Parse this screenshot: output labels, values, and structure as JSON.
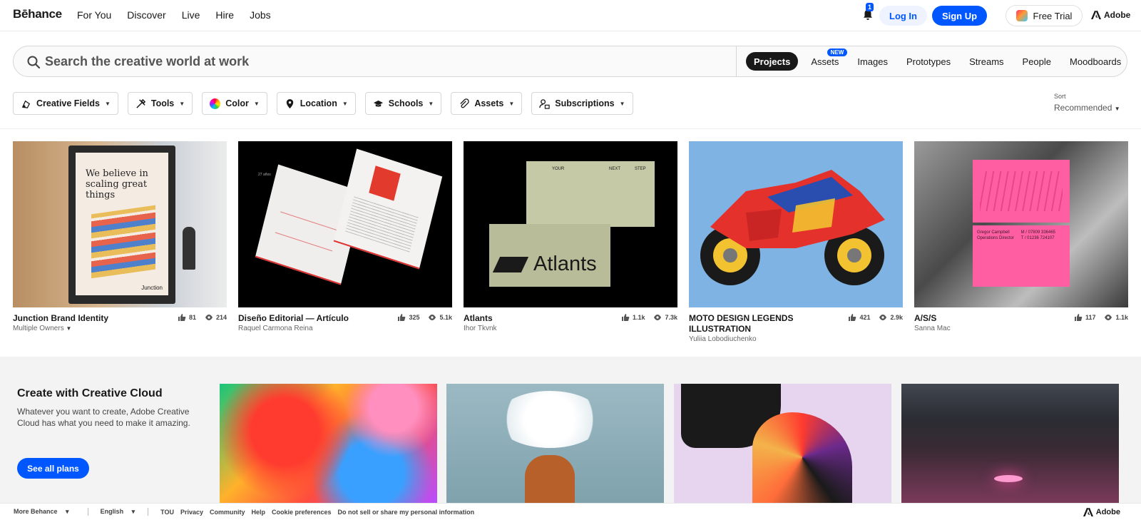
{
  "brand": {
    "logo": "Bēhance"
  },
  "nav": {
    "links": [
      "For You",
      "Discover",
      "Live",
      "Hire",
      "Jobs"
    ]
  },
  "header": {
    "notification_count": "1",
    "login": "Log In",
    "signup": "Sign Up",
    "trial": "Free Trial",
    "adobe": "Adobe"
  },
  "search": {
    "placeholder": "Search the creative world at work",
    "tabs": [
      "Projects",
      "Assets",
      "Images",
      "Prototypes",
      "Streams",
      "People",
      "Moodboards"
    ],
    "active_tab": "Projects",
    "new_badge": "NEW"
  },
  "filters": {
    "items": [
      "Creative Fields",
      "Tools",
      "Color",
      "Location",
      "Schools",
      "Assets",
      "Subscriptions"
    ]
  },
  "sort": {
    "label": "Sort",
    "value": "Recommended"
  },
  "projects": [
    {
      "title": "Junction Brand Identity",
      "owner": "Multiple Owners",
      "likes": "81",
      "views": "214"
    },
    {
      "title": "Diseño Editorial — Artículo",
      "owner": "Raquel Carmona Reina",
      "likes": "325",
      "views": "5.1k"
    },
    {
      "title": "Atlants",
      "owner": "Ihor Tkvnk",
      "likes": "1.1k",
      "views": "7.3k"
    },
    {
      "title": "MOTO DESIGN LEGENDS ILLUSTRATION",
      "owner": "Yuliia Lobodiuchenko",
      "likes": "421",
      "views": "2.9k"
    },
    {
      "title": "A/S/S",
      "owner": "Sanna Mac",
      "likes": "117",
      "views": "1.1k"
    }
  ],
  "thumb_text": {
    "poster_line1": "We believe in",
    "poster_line2": "scaling great",
    "poster_line3": "things",
    "poster_brand": "Junction",
    "atlants_word": "Atlants",
    "env_your": "YOUR",
    "env_next": "NEXT",
    "env_step": "STEP",
    "card_name": "Gregor Campbell",
    "card_role": "Operations Director",
    "card_phone1": "M / 07809 336465",
    "card_phone2": "T / 01236 724107",
    "mag_label": "27 años"
  },
  "cc": {
    "title": "Create with Creative Cloud",
    "text": "Whatever you want to create, Adobe Creative Cloud has what you need to make it amazing.",
    "button": "See all plans"
  },
  "footer": {
    "more": "More Behance",
    "language": "English",
    "links": [
      "TOU",
      "Privacy",
      "Community",
      "Help",
      "Cookie preferences",
      "Do not sell or share my personal information"
    ],
    "adobe": "Adobe"
  }
}
